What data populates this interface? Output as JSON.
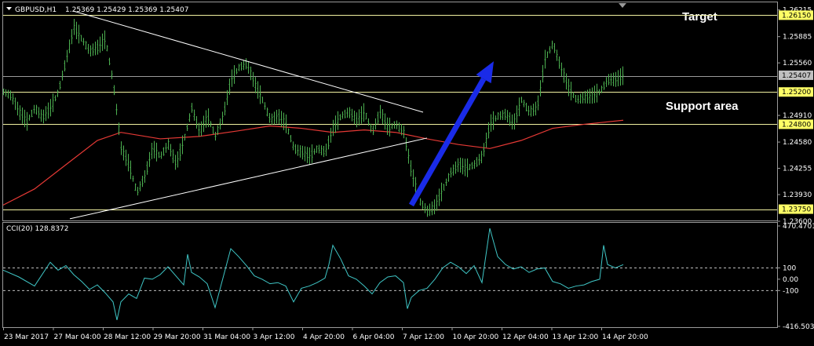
{
  "header": {
    "symbol_label": "GBPUSD,H1",
    "ohlc": "1.25369 1.25429 1.25369 1.25407"
  },
  "annotations": {
    "target": "Target",
    "support": "Support area"
  },
  "indicator": {
    "label": "CCI(20) 128.8372",
    "max_label": "470.4701",
    "min_label": "-416.5031"
  },
  "colors": {
    "candle": "#4caf50",
    "ma": "#e53935",
    "arrow": "#1a2be8",
    "level_line": "#f0f0a0",
    "cci": "#3fc6c6",
    "grid": "#9a9a9a"
  },
  "chart_data": [
    {
      "type": "line",
      "title": "GBPUSD,H1",
      "y_tick_labels": [
        "1.26215",
        "1.25885",
        "1.25560",
        "1.24910",
        "1.24580",
        "1.24255",
        "1.23930",
        "1.23600"
      ],
      "price_tags": [
        "1.26150",
        "1.25407",
        "1.25200",
        "1.24800",
        "1.23750"
      ],
      "x_tick_labels": [
        "23 Mar 2017",
        "27 Mar 04:00",
        "28 Mar 12:00",
        "29 Mar 20:00",
        "31 Mar 04:00",
        "3 Apr 12:00",
        "4 Apr 20:00",
        "6 Apr 04:00",
        "7 Apr 12:00",
        "10 Apr 20:00",
        "12 Apr 04:00",
        "13 Apr 12:00",
        "14 Apr 20:00"
      ],
      "ylim": [
        1.236,
        1.2628
      ],
      "horizontal_levels": [
        1.2615,
        1.254,
        1.252,
        1.248,
        1.2375
      ],
      "price_path": [
        [
          0,
          1.252
        ],
        [
          10,
          1.2515
        ],
        [
          20,
          1.2495
        ],
        [
          30,
          1.2483
        ],
        [
          40,
          1.25
        ],
        [
          50,
          1.2488
        ],
        [
          60,
          1.25
        ],
        [
          70,
          1.252
        ],
        [
          80,
          1.256
        ],
        [
          90,
          1.26
        ],
        [
          100,
          1.2585
        ],
        [
          110,
          1.257
        ],
        [
          120,
          1.2575
        ],
        [
          130,
          1.2585
        ],
        [
          140,
          1.253
        ],
        [
          150,
          1.245
        ],
        [
          160,
          1.243
        ],
        [
          170,
          1.2395
        ],
        [
          180,
          1.2415
        ],
        [
          190,
          1.245
        ],
        [
          200,
          1.244
        ],
        [
          210,
          1.2455
        ],
        [
          220,
          1.243
        ],
        [
          230,
          1.246
        ],
        [
          240,
          1.25
        ],
        [
          250,
          1.247
        ],
        [
          260,
          1.249
        ],
        [
          270,
          1.2465
        ],
        [
          280,
          1.249
        ],
        [
          290,
          1.2535
        ],
        [
          300,
          1.255
        ],
        [
          310,
          1.2555
        ],
        [
          320,
          1.253
        ],
        [
          330,
          1.251
        ],
        [
          340,
          1.2485
        ],
        [
          350,
          1.249
        ],
        [
          360,
          1.248
        ],
        [
          370,
          1.245
        ],
        [
          380,
          1.2445
        ],
        [
          390,
          1.244
        ],
        [
          400,
          1.245
        ],
        [
          410,
          1.2445
        ],
        [
          420,
          1.2475
        ],
        [
          430,
          1.249
        ],
        [
          440,
          1.2495
        ],
        [
          450,
          1.2485
        ],
        [
          460,
          1.2495
        ],
        [
          470,
          1.247
        ],
        [
          480,
          1.2495
        ],
        [
          490,
          1.2475
        ],
        [
          500,
          1.248
        ],
        [
          510,
          1.247
        ],
        [
          520,
          1.242
        ],
        [
          530,
          1.2385
        ],
        [
          540,
          1.2372
        ],
        [
          550,
          1.2378
        ],
        [
          560,
          1.24
        ],
        [
          570,
          1.242
        ],
        [
          580,
          1.243
        ],
        [
          590,
          1.2425
        ],
        [
          600,
          1.243
        ],
        [
          610,
          1.244
        ],
        [
          620,
          1.248
        ],
        [
          630,
          1.249
        ],
        [
          640,
          1.2492
        ],
        [
          650,
          1.248
        ],
        [
          660,
          1.251
        ],
        [
          670,
          1.2495
        ],
        [
          680,
          1.25
        ],
        [
          690,
          1.256
        ],
        [
          700,
          1.258
        ],
        [
          710,
          1.255
        ],
        [
          720,
          1.2525
        ],
        [
          730,
          1.251
        ],
        [
          740,
          1.2513
        ],
        [
          750,
          1.2515
        ],
        [
          760,
          1.252
        ],
        [
          770,
          1.2535
        ],
        [
          780,
          1.2535
        ],
        [
          790,
          1.254
        ]
      ],
      "moving_average": [
        [
          0,
          1.238
        ],
        [
          40,
          1.24
        ],
        [
          80,
          1.243
        ],
        [
          120,
          1.246
        ],
        [
          150,
          1.247
        ],
        [
          200,
          1.2462
        ],
        [
          250,
          1.2465
        ],
        [
          300,
          1.2472
        ],
        [
          340,
          1.2478
        ],
        [
          380,
          1.2475
        ],
        [
          420,
          1.247
        ],
        [
          460,
          1.2473
        ],
        [
          500,
          1.247
        ],
        [
          540,
          1.2462
        ],
        [
          580,
          1.2455
        ],
        [
          620,
          1.245
        ],
        [
          660,
          1.246
        ],
        [
          700,
          1.2475
        ],
        [
          740,
          1.248
        ],
        [
          790,
          1.2485
        ]
      ],
      "trendlines": [
        {
          "from": [
            90,
            1.262
          ],
          "to": [
            535,
            1.2495
          ]
        },
        {
          "from": [
            85,
            1.2363
          ],
          "to": [
            540,
            1.2463
          ]
        }
      ],
      "arrow": {
        "from": [
          520,
          1.238
        ],
        "to": [
          625,
          1.2558
        ]
      }
    },
    {
      "type": "line",
      "title": "CCI(20) 128.8372",
      "ylim": [
        -416.5031,
        470.4701
      ],
      "y_tick_labels": [
        "470.4701",
        "100",
        "0.00",
        "-100",
        "-416.5031"
      ],
      "levels": [
        100,
        -100
      ],
      "cci_path": [
        [
          0,
          80
        ],
        [
          20,
          20
        ],
        [
          40,
          -60
        ],
        [
          60,
          150
        ],
        [
          70,
          80
        ],
        [
          80,
          120
        ],
        [
          90,
          40
        ],
        [
          100,
          -20
        ],
        [
          110,
          -90
        ],
        [
          120,
          -50
        ],
        [
          130,
          -120
        ],
        [
          140,
          -200
        ],
        [
          145,
          -360
        ],
        [
          150,
          -200
        ],
        [
          160,
          -130
        ],
        [
          170,
          -170
        ],
        [
          180,
          10
        ],
        [
          190,
          0
        ],
        [
          200,
          40
        ],
        [
          210,
          110
        ],
        [
          220,
          30
        ],
        [
          230,
          -50
        ],
        [
          235,
          220
        ],
        [
          240,
          60
        ],
        [
          250,
          20
        ],
        [
          260,
          -40
        ],
        [
          270,
          -250
        ],
        [
          280,
          10
        ],
        [
          290,
          270
        ],
        [
          300,
          200
        ],
        [
          310,
          120
        ],
        [
          320,
          30
        ],
        [
          330,
          0
        ],
        [
          340,
          -40
        ],
        [
          350,
          -30
        ],
        [
          360,
          -60
        ],
        [
          370,
          -200
        ],
        [
          380,
          -80
        ],
        [
          390,
          -60
        ],
        [
          400,
          -30
        ],
        [
          410,
          10
        ],
        [
          415,
          130
        ],
        [
          420,
          300
        ],
        [
          430,
          180
        ],
        [
          440,
          30
        ],
        [
          450,
          0
        ],
        [
          460,
          -60
        ],
        [
          470,
          -130
        ],
        [
          480,
          -30
        ],
        [
          490,
          20
        ],
        [
          500,
          30
        ],
        [
          510,
          -30
        ],
        [
          515,
          -260
        ],
        [
          520,
          -160
        ],
        [
          530,
          -100
        ],
        [
          540,
          -80
        ],
        [
          550,
          0
        ],
        [
          560,
          100
        ],
        [
          570,
          150
        ],
        [
          580,
          110
        ],
        [
          590,
          50
        ],
        [
          600,
          120
        ],
        [
          610,
          -30
        ],
        [
          620,
          450
        ],
        [
          630,
          200
        ],
        [
          640,
          130
        ],
        [
          650,
          90
        ],
        [
          660,
          110
        ],
        [
          670,
          60
        ],
        [
          680,
          90
        ],
        [
          690,
          100
        ],
        [
          700,
          -20
        ],
        [
          710,
          -40
        ],
        [
          720,
          -80
        ],
        [
          730,
          -60
        ],
        [
          740,
          -50
        ],
        [
          750,
          -20
        ],
        [
          760,
          0
        ],
        [
          765,
          300
        ],
        [
          770,
          130
        ],
        [
          780,
          100
        ],
        [
          790,
          128.8372
        ]
      ]
    }
  ]
}
